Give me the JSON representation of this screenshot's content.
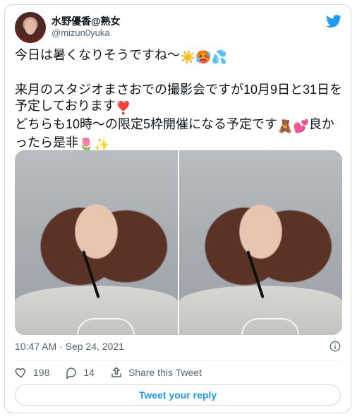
{
  "tweet": {
    "author": {
      "name": "水野優香@熟女",
      "handle": "@mizun0yuka"
    },
    "lines": [
      "今日は暑くなりそうですね〜",
      "",
      "来月のスタジオまさおでの撮影会ですが10月9日と31日を予定しております",
      "どちらも10時〜の限定5枠開催になる予定です",
      "良かったら是非"
    ],
    "emojis": {
      "line1": [
        "☀️",
        "🥵",
        "💦"
      ],
      "line3": [
        "❣️"
      ],
      "line4": [
        "🧸",
        "💕"
      ],
      "line5": [
        "🌷",
        "✨"
      ]
    },
    "meta": {
      "time": "10:47 AM",
      "date": "Sep 24, 2021"
    },
    "actions": {
      "likes": "198",
      "replies": "14",
      "share_label": "Share this Tweet"
    },
    "reply_button": "Tweet your reply"
  },
  "colors": {
    "accent": "#1d9bf0",
    "muted": "#536471",
    "border": "#cfd9de"
  },
  "icons": {
    "brand": "twitter-bird-icon",
    "info": "info-icon",
    "like": "heart-icon",
    "reply": "reply-icon",
    "share": "share-icon"
  }
}
